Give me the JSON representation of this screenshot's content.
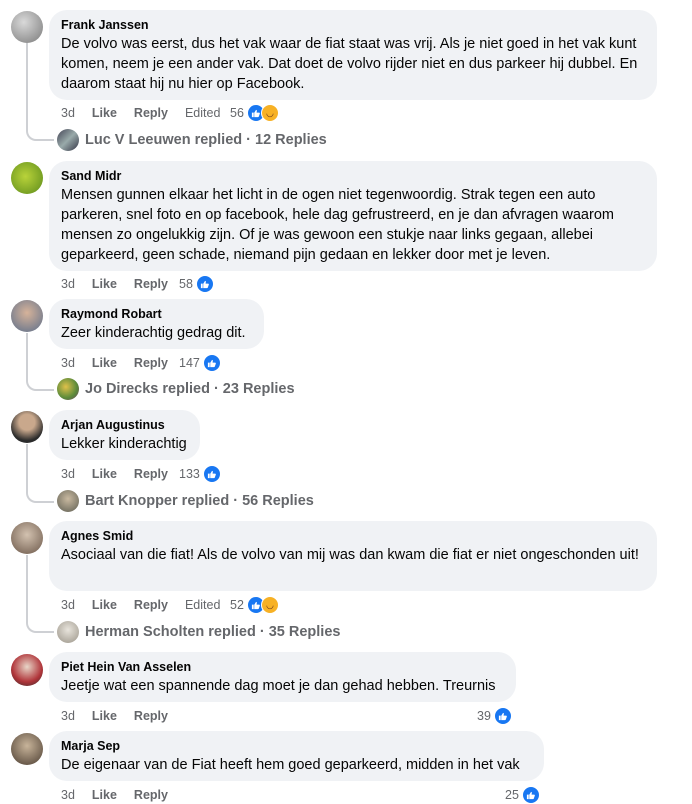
{
  "comments": [
    {
      "author": "Frank Janssen",
      "text": "De volvo was eerst, dus het vak waar de fiat staat was vrij. Als je niet goed in het vak kunt komen, neem je een ander vak. Dat doet de volvo rijder niet en dus parkeer hij dubbel. En daarom staat hij nu hier op Facebook.",
      "time": "3d",
      "like": "Like",
      "reply": "Reply",
      "edited": "Edited",
      "reactions": "56",
      "replies": "Luc V Leeuwen replied · 12 Replies"
    },
    {
      "author": "Sand Midr",
      "text": "Mensen gunnen elkaar het licht in de ogen niet tegenwoordig. Strak tegen een auto parkeren, snel foto en op facebook, hele dag gefrustreerd, en je dan afvragen waarom mensen zo ongelukkig zijn. Of je was gewoon een stukje naar links gegaan, allebei geparkeerd, geen schade, niemand pijn gedaan en lekker door met je leven.",
      "time": "3d",
      "like": "Like",
      "reply": "Reply",
      "reactions": "58"
    },
    {
      "author": "Raymond Robart",
      "text": "Zeer kinderachtig gedrag dit.",
      "time": "3d",
      "like": "Like",
      "reply": "Reply",
      "reactions": "147",
      "replies": "Jo Direcks replied · 23 Replies"
    },
    {
      "author": "Arjan Augustinus",
      "text": "Lekker kinderachtig",
      "time": "3d",
      "like": "Like",
      "reply": "Reply",
      "reactions": "133",
      "replies": "Bart Knopper replied · 56 Replies"
    },
    {
      "author": "Agnes Smid",
      "text": "Asociaal van die fiat! Als de volvo van mij was dan kwam die fiat er niet ongeschonden uit!",
      "time": "3d",
      "like": "Like",
      "reply": "Reply",
      "edited": "Edited",
      "reactions": "52",
      "replies": "Herman Scholten replied · 35 Replies"
    },
    {
      "author": "Piet Hein Van Asselen",
      "text": "Jeetje wat een spannende dag moet je dan gehad hebben. Treurnis",
      "time": "3d",
      "like": "Like",
      "reply": "Reply",
      "reactions": "39"
    },
    {
      "author": "Marja Sep",
      "text": "De eigenaar van de Fiat heeft hem goed geparkeerd, midden in het vak",
      "time": "3d",
      "like": "Like",
      "reply": "Reply",
      "reactions": "25"
    }
  ],
  "colors": {
    "bubble": "#f0f2f5",
    "meta": "#65676b",
    "like_blue": "#1877f2",
    "haha_yellow": "#f7b125"
  }
}
